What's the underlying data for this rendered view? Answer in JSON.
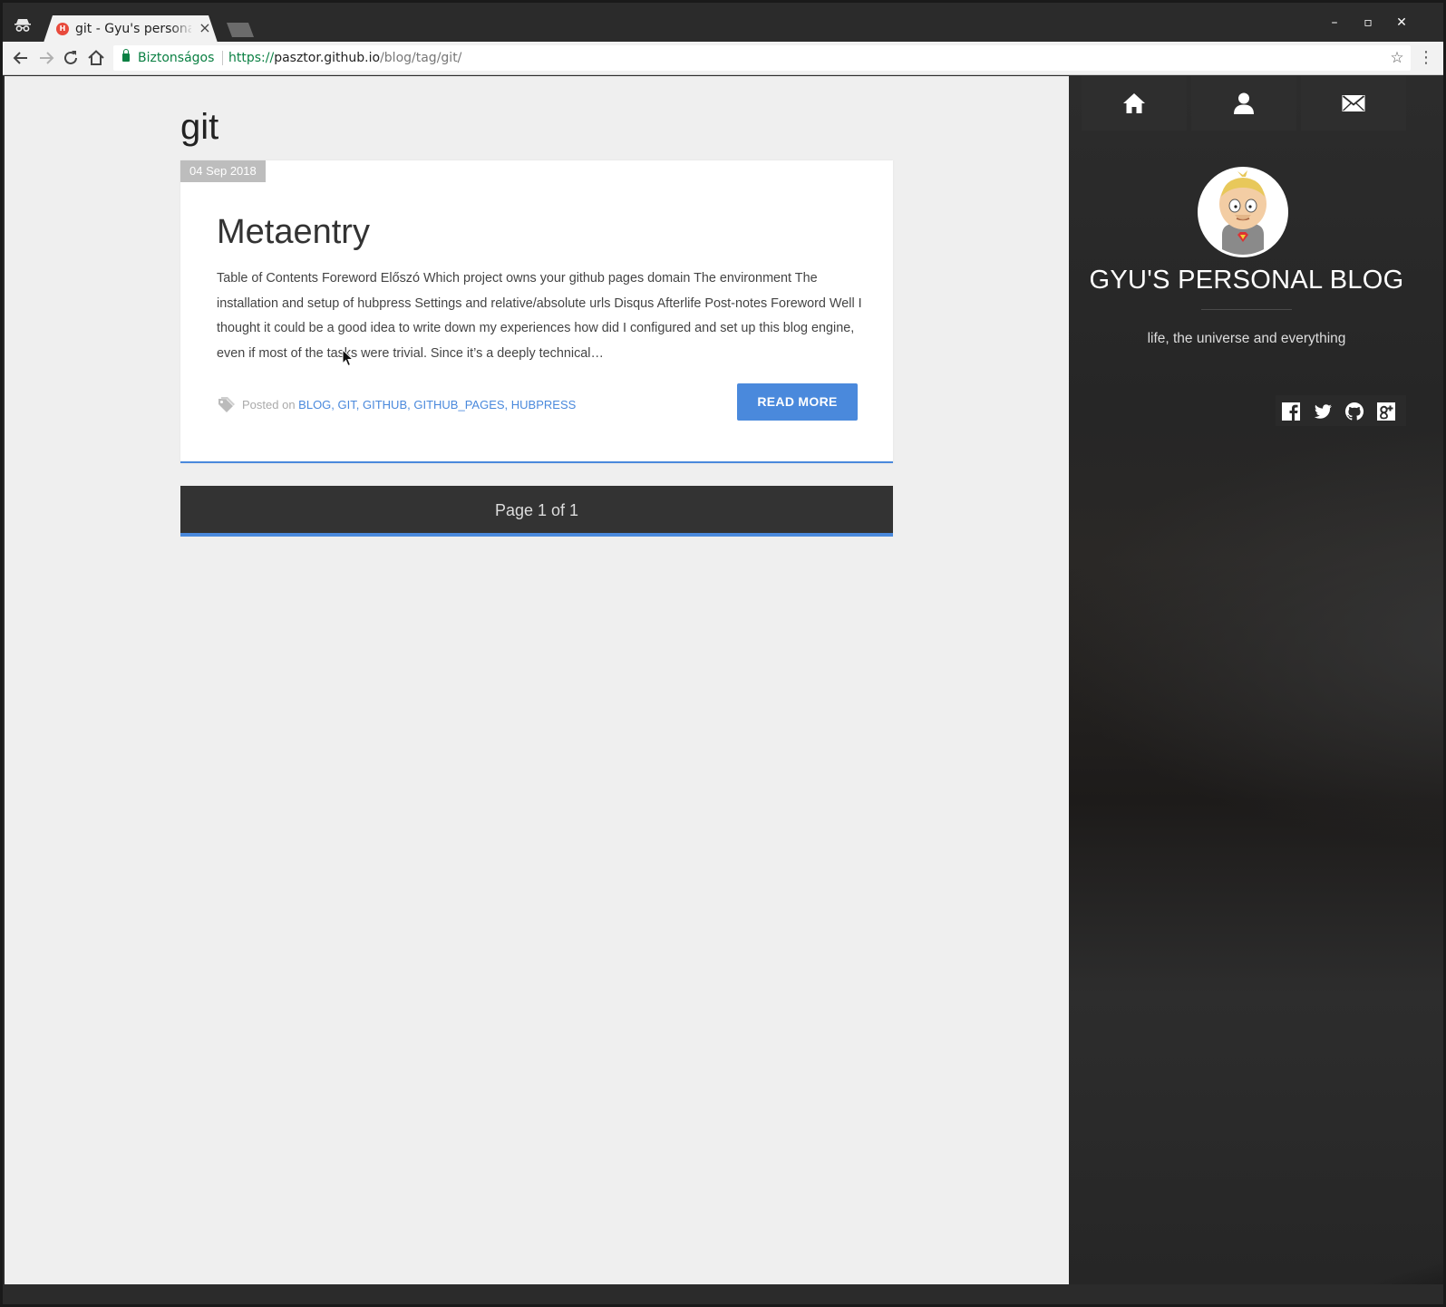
{
  "browser": {
    "tab_title": "git - Gyu's personal blog",
    "tab_favicon_letter": "H",
    "tab_close": "×",
    "security_label": "Biztonságos",
    "url_scheme": "https://",
    "url_host": "pasztor.github.io",
    "url_path": "/blog/tag/git/",
    "window_controls": [
      "–",
      "▫",
      "✕"
    ]
  },
  "page": {
    "heading": "git",
    "posts": [
      {
        "date": "04 Sep 2018",
        "title": "Metaentry",
        "excerpt": "Table of Contents Foreword Előszó Which project owns your github pages domain The environment The installation and setup of hubpress Settings and relative/absolute urls Disqus Afterlife Post-notes Foreword Well I thought it could be a good idea to write down my experiences how did I configured and set up this blog engine, even if most of the tasks were trivial. Since it’s a deeply technical…",
        "posted_on": "Posted on",
        "tags": [
          "BLOG",
          "GIT",
          "GITHUB",
          "GITHUB_PAGES",
          "HUBPRESS"
        ],
        "read_more": "READ MORE"
      }
    ],
    "pagination": "Page 1 of 1"
  },
  "sidebar": {
    "nav": [
      {
        "icon": "home-icon"
      },
      {
        "icon": "user-icon"
      },
      {
        "icon": "envelope-icon"
      }
    ],
    "blog_title": "GYU'S PERSONAL BLOG",
    "tagline": "life, the universe and everything",
    "social": [
      "facebook-icon",
      "twitter-icon",
      "github-icon",
      "google-plus-icon"
    ]
  },
  "colors": {
    "accent": "#4a89dc",
    "sidebar_bg": "#2b2b2b",
    "page_bg": "#efefef",
    "secure_green": "#0b8043"
  }
}
